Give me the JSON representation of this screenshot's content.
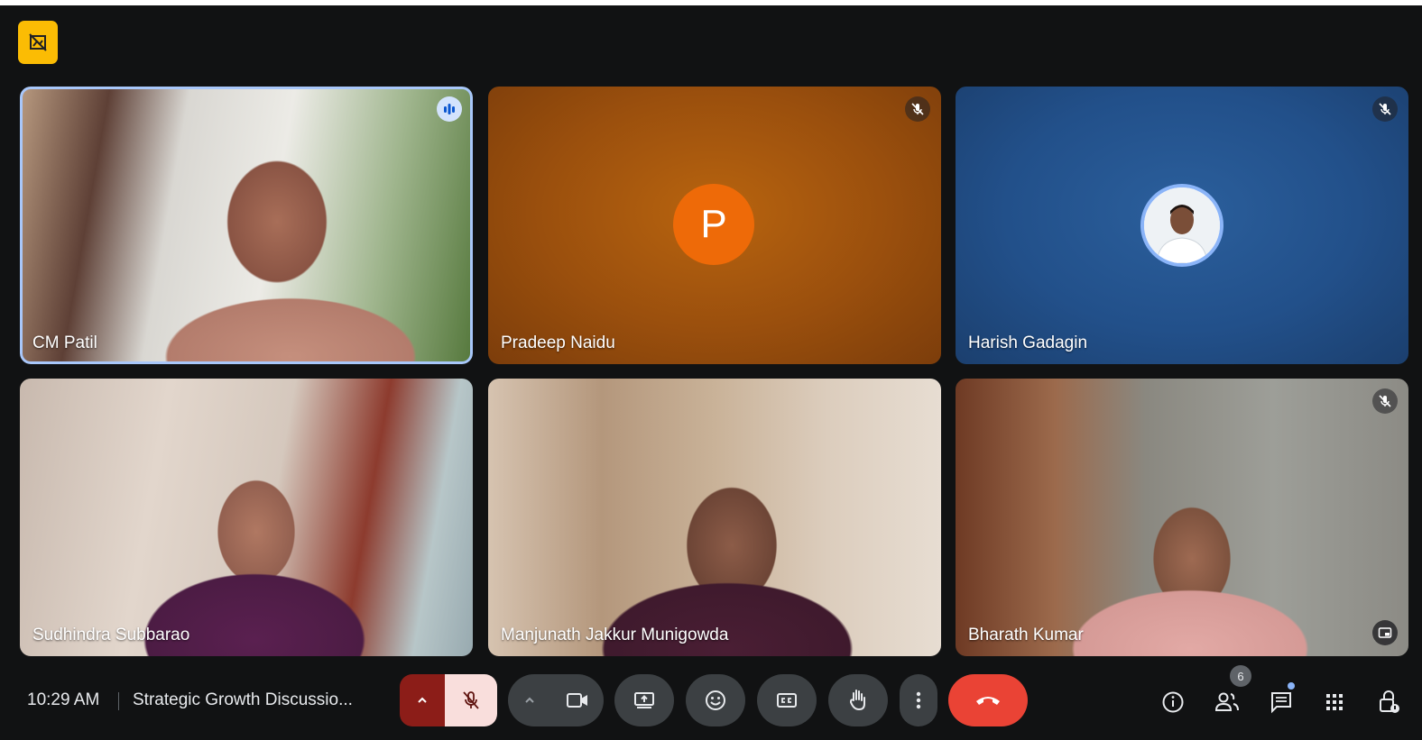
{
  "participants": [
    {
      "name": "CM Patil"
    },
    {
      "name": "Pradeep Naidu",
      "initial": "P"
    },
    {
      "name": "Harish Gadagin"
    },
    {
      "name": "Sudhindra Subbarao"
    },
    {
      "name": "Manjunath Jakkur Munigowda"
    },
    {
      "name": "Bharath Kumar"
    }
  ],
  "bottom_bar": {
    "time": "10:29 AM",
    "meeting_title": "Strategic Growth Discussio...",
    "people_count": "6"
  },
  "colors": {
    "end_call": "#ea4335",
    "mic_muted_bg": "#f9dedc",
    "badge": "#fbbc04"
  },
  "icons": [
    "visibility-off-icon",
    "audio-level-icon",
    "mic-off-icon",
    "chevron-up-icon",
    "camera-icon",
    "present-icon",
    "emoji-icon",
    "captions-icon",
    "raise-hand-icon",
    "more-vert-icon",
    "end-call-icon",
    "info-icon",
    "people-icon",
    "chat-icon",
    "apps-icon",
    "host-controls-icon",
    "pip-icon"
  ]
}
